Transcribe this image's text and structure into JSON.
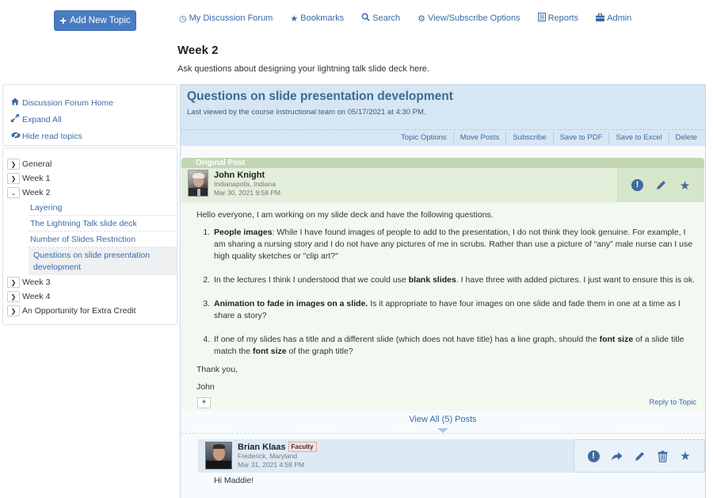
{
  "header": {
    "add_topic_label": "Add New Topic",
    "nav": [
      {
        "icon": "dashboard-icon",
        "glyph": "Ⓐ",
        "label": "My Discussion Forum"
      },
      {
        "icon": "star-icon",
        "glyph": "★",
        "label": "Bookmarks"
      },
      {
        "icon": "search-icon",
        "glyph": "⌕",
        "label": "Search"
      },
      {
        "icon": "gear-icon",
        "glyph": "⚙",
        "label": "View/Subscribe Options"
      },
      {
        "icon": "reports-icon",
        "glyph": "▤",
        "label": "Reports"
      },
      {
        "icon": "briefcase-icon",
        "glyph": "▣",
        "label": "Admin"
      }
    ]
  },
  "page": {
    "title": "Week 2",
    "description": "Ask questions about designing your lightning talk slide deck here."
  },
  "sidebar": {
    "links": [
      {
        "icon": "home-icon",
        "label": "Discussion Forum Home"
      },
      {
        "icon": "expand-icon",
        "label": "Expand All"
      },
      {
        "icon": "eye-slash-icon",
        "label": "Hide read topics"
      }
    ],
    "tree": {
      "before": [
        {
          "label": "General",
          "expanded": false
        },
        {
          "label": "Week 1",
          "expanded": false
        },
        {
          "label": "Week 2",
          "expanded": true
        }
      ],
      "week2_topics": [
        {
          "label": "Layering"
        },
        {
          "label": "The Lightning Talk slide deck"
        },
        {
          "label": "Number of Slides Restriction"
        },
        {
          "label": "Questions on slide presentation development",
          "active": true
        }
      ],
      "after": [
        {
          "label": "Week 3",
          "expanded": false
        },
        {
          "label": "Week 4",
          "expanded": false
        },
        {
          "label": "An Opportunity for Extra Credit",
          "expanded": false
        }
      ]
    }
  },
  "topic": {
    "title": "Questions on slide presentation development",
    "last_viewed": "Last viewed by the course instructional team on 05/17/2021 at 4:30 PM.",
    "toolbar": [
      "Topic Options",
      "Move Posts",
      "Subscribe",
      "Save to PDF",
      "Save to Excel",
      "Delete"
    ]
  },
  "original_post": {
    "label": "Original Post",
    "author": "John Knight",
    "location": "Indianapolis, Indiana",
    "date": "Mar 30, 2021 9:58 PM",
    "intro": "Hello everyone, I am working on my slide deck and have the following questions.",
    "items": [
      {
        "bold": "People images",
        "text": ": While I have found images of people to add to the presentation, I do not think they look genuine. For example, I am sharing a nursing story and I do not have any pictures of me in scrubs. Rather than use a picture of “any” male nurse can I use high quality sketches or \"clip art?\""
      },
      {
        "pre": "In the lectures I think I understood that we could use ",
        "bold": "blank slides",
        "text": ". I have three with added pictures. I just want to ensure this is ok."
      },
      {
        "bold": "Animation to fade in images on a slide.",
        "text": " Is it appropriate to have four images on one slide and fade them in one at a time as I share a story?"
      },
      {
        "pre": "If one of my slides has a title and a different slide (which does not have title) has a line graph, should the ",
        "bold": "font size",
        "mid": " of a slide title match the ",
        "bold2": "font size",
        "text": " of the graph title?"
      }
    ],
    "closing": "Thank you,",
    "signature": "John",
    "reply_label": "Reply to Topic",
    "expand_label": "+"
  },
  "view_all_label": "View All (5) Posts",
  "reply_post": {
    "author": "Brian Klaas",
    "badge": "Faculty",
    "location": "Frederick, Maryland",
    "date": "Mar 31, 2021 4:58 PM",
    "text": "Hi Maddie!"
  }
}
